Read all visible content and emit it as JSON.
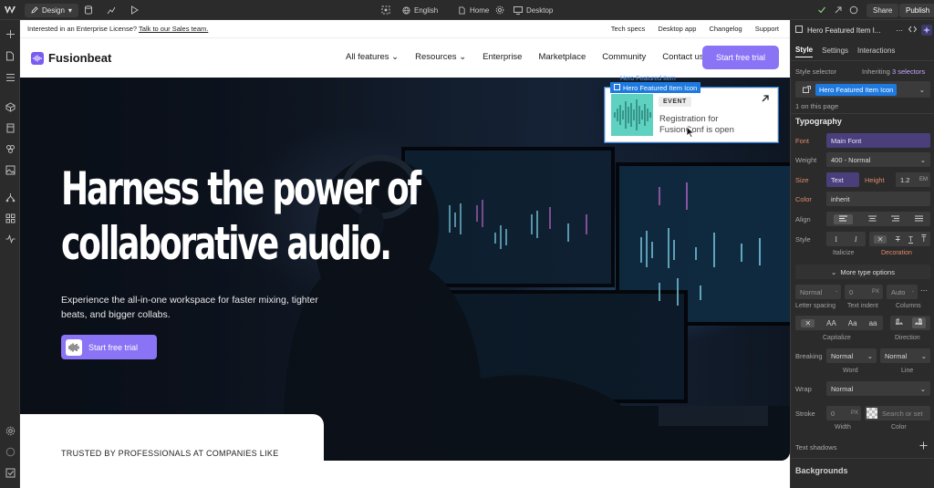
{
  "topbar": {
    "mode_label": "Design",
    "locale_label": "English",
    "page_label": "Home",
    "device_label": "Desktop",
    "share_label": "Share",
    "publish_label": "Publish"
  },
  "canvas": {
    "announce": {
      "text": "Interested in an Enterprise License?",
      "link": "Talk to our Sales team.",
      "links": [
        "Tech specs",
        "Desktop app",
        "Changelog",
        "Support"
      ]
    },
    "nav": {
      "brand": "Fusionbeat",
      "items": [
        "All features",
        "Resources",
        "Enterprise",
        "Marketplace",
        "Community",
        "Contact us"
      ],
      "cta": "Start free trial"
    },
    "hero": {
      "title_line1": "Harness the power of",
      "title_line2": "collaborative audio.",
      "subtitle": "Experience the all-in-one workspace for faster mixing, tighter beats, and bigger collabs.",
      "cta": "Start free trial"
    },
    "featured_card": {
      "badge": "EVENT",
      "text": "Registration for FusionConf is open"
    },
    "selection_label": "Hero Featured Item Icon",
    "selection_ghost": "Hero Featured Item",
    "trusted": "TRUSTED BY PROFESSIONALS AT COMPANIES LIKE"
  },
  "panel": {
    "element_title": "Hero Featured Item I...",
    "tabs": [
      "Style",
      "Settings",
      "Interactions"
    ],
    "style_selector_label": "Style selector",
    "inheriting_label": "Inheriting",
    "inheriting_count": "3 selectors",
    "selector_chip": "Hero Featured Item Icon",
    "on_page": "1 on this page",
    "typography_title": "Typography",
    "font_label": "Font",
    "font_value": "Main Font",
    "weight_label": "Weight",
    "weight_value": "400 - Normal",
    "size_label": "Size",
    "size_value": "Text",
    "height_label": "Height",
    "height_value": "1.2",
    "height_unit": "EM",
    "color_label": "Color",
    "color_value": "inherit",
    "align_label": "Align",
    "style_label": "Style",
    "italicize_cap": "Italicize",
    "decoration_cap": "Decoration",
    "more_options": "More type options",
    "spacing_value": "Normal",
    "indent_value": "0",
    "indent_unit": "PX",
    "columns_value": "Auto",
    "letter_spacing_cap": "Letter spacing",
    "text_indent_cap": "Text indent",
    "columns_cap": "Columns",
    "capitalize_cap": "Capitalize",
    "direction_cap": "Direction",
    "caps_options": [
      "AA",
      "Aa",
      "aa"
    ],
    "breaking_label": "Breaking",
    "breaking_word_value": "Normal",
    "breaking_line_value": "Normal",
    "word_cap": "Word",
    "line_cap": "Line",
    "wrap_label": "Wrap",
    "wrap_value": "Normal",
    "stroke_label": "Stroke",
    "stroke_value": "0",
    "stroke_unit": "PX",
    "stroke_color_placeholder": "Search or set",
    "width_cap": "Width",
    "color_cap": "Color",
    "text_shadows_label": "Text shadows",
    "backgrounds_title": "Backgrounds"
  },
  "colors": {
    "accent": "#8b73f5",
    "selection": "#1f7ae0",
    "panel_bg": "#2b2b2b"
  }
}
